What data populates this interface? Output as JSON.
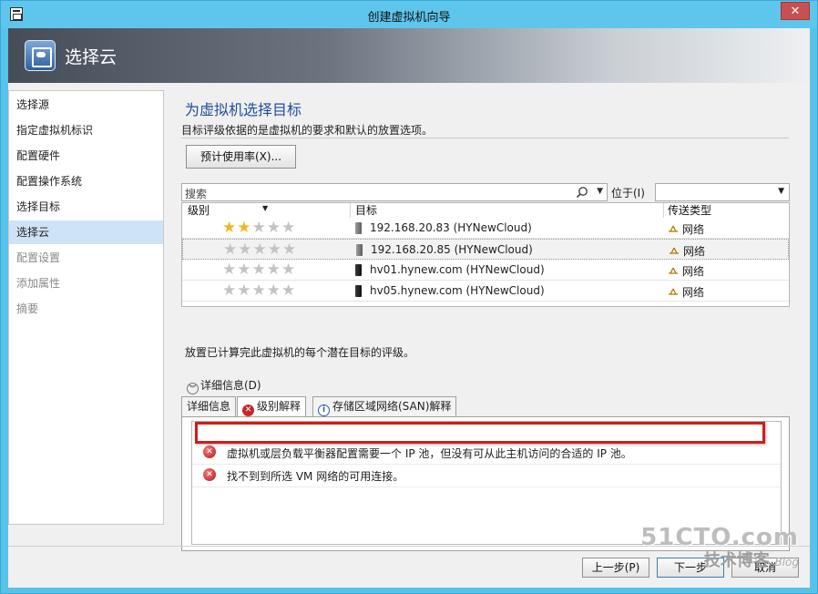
{
  "window": {
    "title": "创建虚拟机向导",
    "close_label": "✕"
  },
  "banner": {
    "title": "选择云",
    "icon": "cloud-icon"
  },
  "sidebar": {
    "items": [
      {
        "label": "选择源",
        "state": "normal"
      },
      {
        "label": "指定虚拟机标识",
        "state": "normal"
      },
      {
        "label": "配置硬件",
        "state": "normal"
      },
      {
        "label": "配置操作系统",
        "state": "normal"
      },
      {
        "label": "选择目标",
        "state": "normal"
      },
      {
        "label": "选择云",
        "state": "selected"
      },
      {
        "label": "配置设置",
        "state": "disabled"
      },
      {
        "label": "添加属性",
        "state": "disabled"
      },
      {
        "label": "摘要",
        "state": "disabled"
      }
    ]
  },
  "main": {
    "heading": "为虚拟机选择目标",
    "description": "目标评级依据的是虚拟机的要求和默认的放置选项。",
    "estimate_button": "预计使用率(X)...",
    "search": {
      "placeholder": "搜索",
      "located_label": "位于(I)",
      "located_value": ""
    },
    "grid": {
      "headers": {
        "rating": "级别",
        "target": "目标",
        "transfer": "传送类型"
      },
      "rows": [
        {
          "stars": 2,
          "target": "192.168.20.83 (HYNewCloud)",
          "transfer": "网络",
          "host_icon": "gray",
          "selected": false
        },
        {
          "stars": 0,
          "target": "192.168.20.85 (HYNewCloud)",
          "transfer": "网络",
          "host_icon": "gray",
          "selected": true
        },
        {
          "stars": 0,
          "target": "hv01.hynew.com (HYNewCloud)",
          "transfer": "网络",
          "host_icon": "dark",
          "selected": false
        },
        {
          "stars": 0,
          "target": "hv05.hynew.com (HYNewCloud)",
          "transfer": "网络",
          "host_icon": "dark",
          "selected": false
        }
      ]
    },
    "note": "放置已计算完此虚拟机的每个潜在目标的评级。",
    "details_toggle": "详细信息(D)",
    "tabs": [
      {
        "label": "详细信息",
        "icon": ""
      },
      {
        "label": "级别解释",
        "icon": "error"
      },
      {
        "label": "存储区域网络(SAN)解释",
        "icon": "info"
      }
    ],
    "explanations": [
      "",
      "虚拟机或层负载平衡器配置需要一个 IP 池，但没有可从此主机访问的合适的 IP 池。",
      "找不到到所选 VM 网络的可用连接。"
    ]
  },
  "footer": {
    "prev": "上一步(P)",
    "next": "下一步",
    "cancel": "取消"
  },
  "watermark": {
    "big": "51CTO.com",
    "small": "技术博客",
    "blog": "Blog"
  },
  "colors": {
    "accent": "#1f4e9a",
    "selected": "#cfe3f6",
    "error": "#c62828",
    "highlight_box": "#d01c1c"
  }
}
